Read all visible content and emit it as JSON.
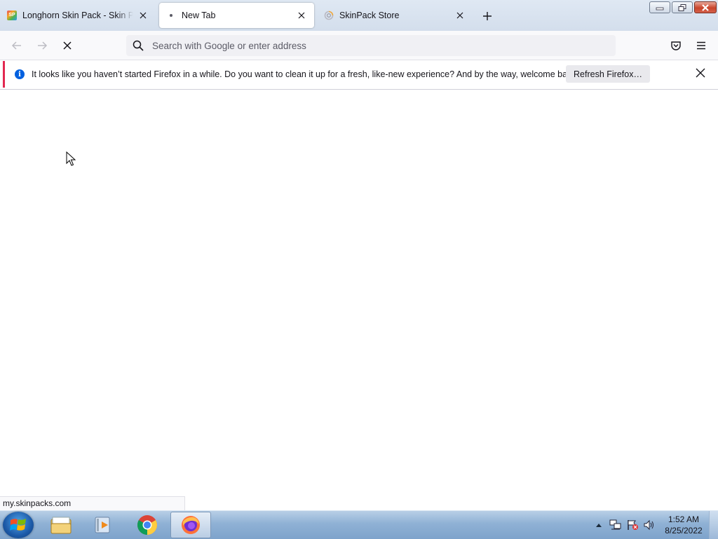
{
  "tabs": [
    {
      "title": "Longhorn Skin Pack - Skin Pack",
      "favicon": "skinpack-logo-icon",
      "selected": false
    },
    {
      "title": "New Tab",
      "favicon": "loading-dot-icon",
      "selected": true
    },
    {
      "title": "SkinPack Store",
      "favicon": "loading-spinner-icon",
      "selected": false
    }
  ],
  "favicon_text": "SP",
  "urlbar": {
    "placeholder": "Search with Google or enter address",
    "value": ""
  },
  "notification": {
    "message": "It looks like you haven’t started Firefox in a while. Do you want to clean it up for a fresh, like-new experience? And by the way, welcome back!",
    "button_label": "Refresh Firefox…",
    "accent_color": "#e22850"
  },
  "status": {
    "url": "my.skinpacks.com"
  },
  "taskbar": {
    "apps": [
      "windows-explorer-icon",
      "media-player-icon",
      "chrome-icon",
      "firefox-icon"
    ],
    "active_app": "firefox-icon"
  },
  "clock": {
    "time": "1:52 AM",
    "date": "8/25/2022"
  }
}
